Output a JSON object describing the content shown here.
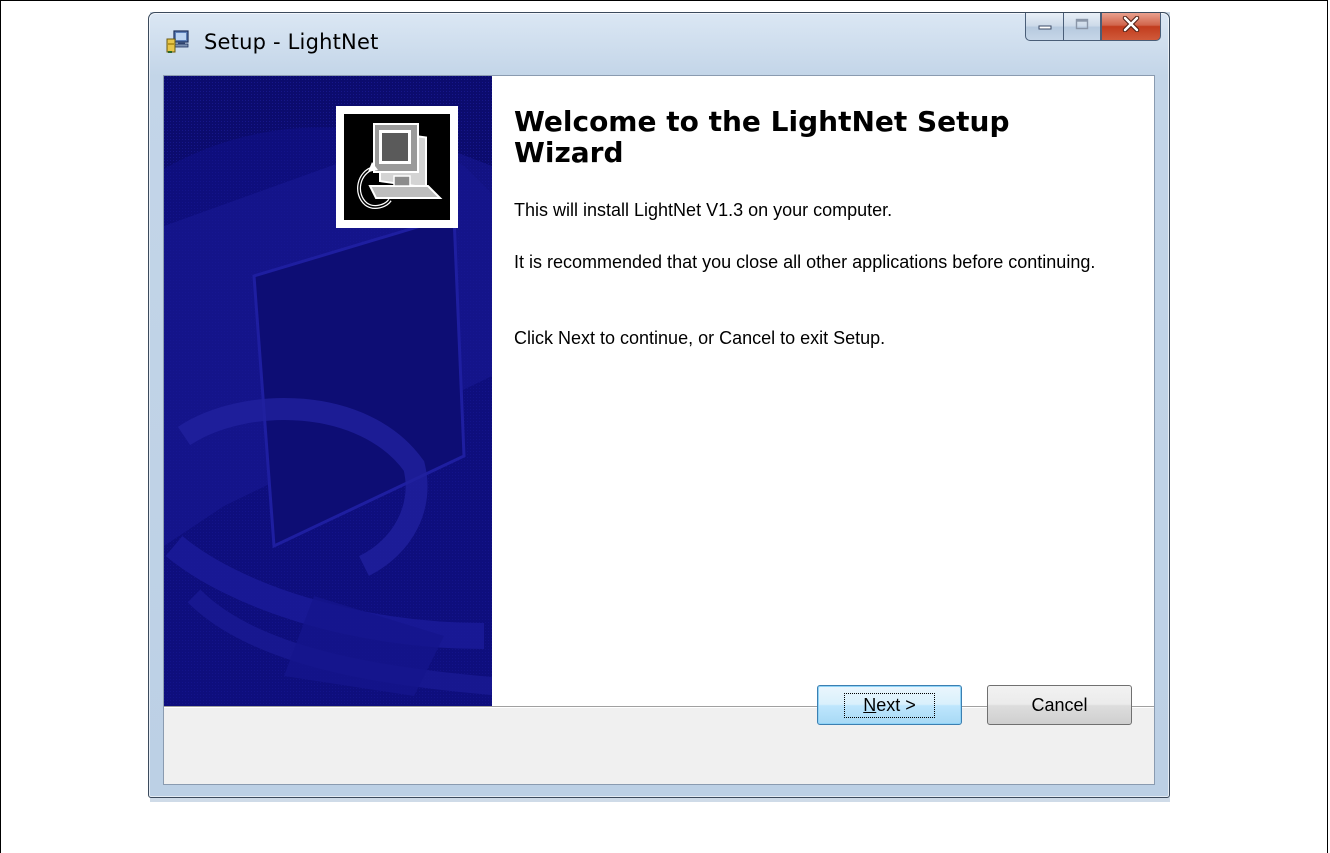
{
  "window": {
    "title": "Setup - LightNet",
    "icon": "setup-installer-icon",
    "caption_buttons": [
      {
        "name": "minimize",
        "icon": "minimize-icon"
      },
      {
        "name": "maximize",
        "icon": "maximize-icon"
      },
      {
        "name": "close",
        "icon": "close-icon"
      }
    ]
  },
  "wizard": {
    "side_image_icon": "computer-install-icon",
    "heading": "Welcome to the LightNet Setup Wizard",
    "paragraphs": {
      "install": "This will install LightNet V1.3 on your computer.",
      "recommend": "It is recommended that you close all other applications before continuing.",
      "instructions": "Click Next to continue, or Cancel to exit Setup."
    }
  },
  "buttons": {
    "next_label": "Next >",
    "cancel_label": "Cancel"
  },
  "colors": {
    "side_panel": "#0b0b6e",
    "close_button": "#c8432a",
    "next_button_border": "#3c7fb1"
  }
}
